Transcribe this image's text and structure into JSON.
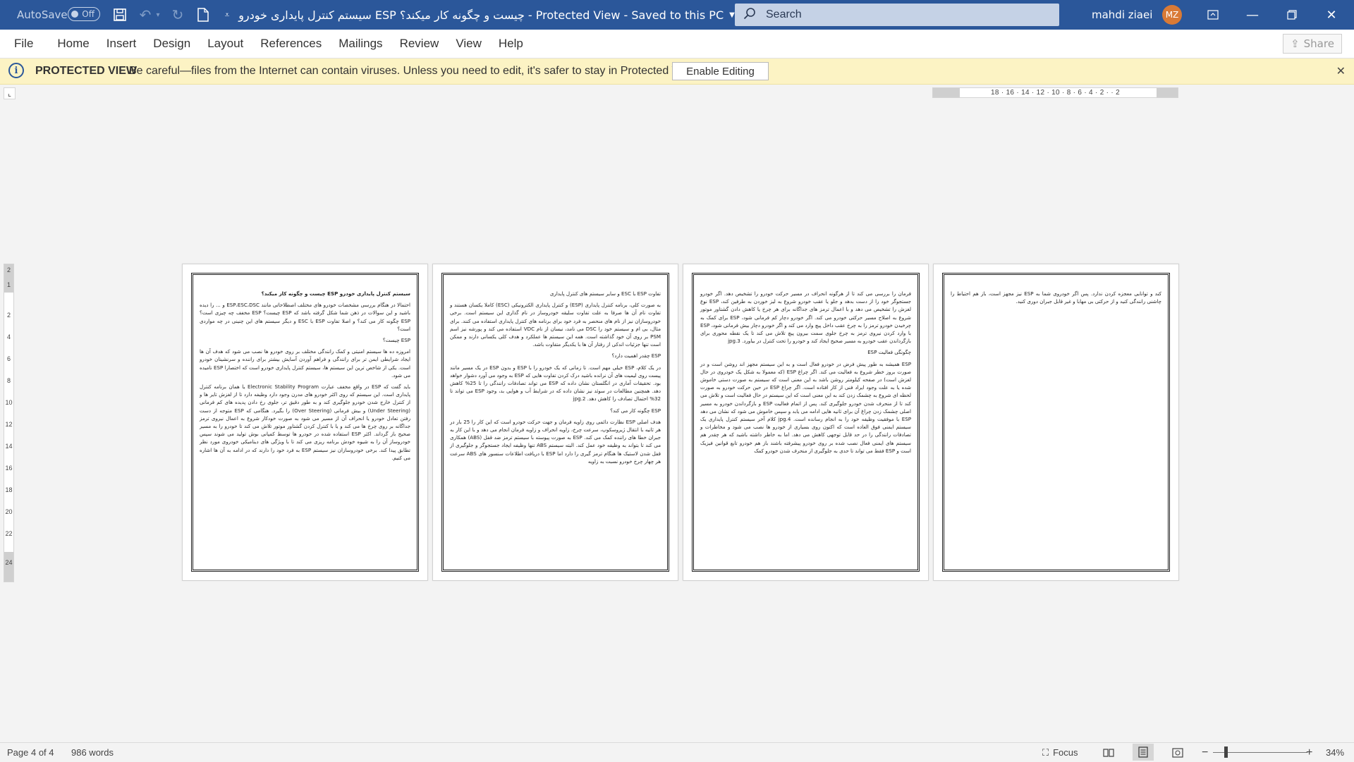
{
  "titlebar": {
    "autosave_label": "AutoSave",
    "autosave_state": "Off",
    "doc_title": "سیستم کنترل پایداری خودرو ESP چیست و چگونه کار میکند؟ - Protected View - Saved to this PC",
    "search_placeholder": "Search",
    "user_name": "mahdi ziaei",
    "user_initials": "MZ",
    "accent_color": "#2b579a",
    "avatar_color": "#d97a36"
  },
  "menu": {
    "tabs": [
      "File",
      "Home",
      "Insert",
      "Design",
      "Layout",
      "References",
      "Mailings",
      "Review",
      "View",
      "Help"
    ],
    "share_label": "Share"
  },
  "protected_view": {
    "title": "PROTECTED VIEW",
    "message": "Be careful—files from the Internet can contain viruses. Unless you need to edit, it's safer to stay in Protected View.",
    "enable_label": "Enable Editing",
    "bar_color": "#fcf3c4"
  },
  "rulers": {
    "horizontal": "2 · · 2 · 4 · 6 · 8 · 10 · 12 · 14 · 16 · 18",
    "vertical": [
      "2",
      "1",
      "2",
      "4",
      "6",
      "8",
      "10",
      "12",
      "14",
      "16",
      "18",
      "20",
      "22",
      "24"
    ]
  },
  "pages": [
    {
      "paragraphs": [
        {
          "heading": true,
          "text": "سیستم کنترل پایداری خودرو ESP چیست و چگونه کار میکند؟"
        },
        {
          "heading": false,
          "text": "احتمالا در هنگام بررسی مشخصات خودرو های مختلف اصطلاحاتی مانند ESP،ESC،DSC و ... را دیده باشید و این سوالات در ذهن شما شکل گرفته باشد که ESP چیست؟ ESP مخفف چه چیزی است؟ ESP چگونه کار می کند؟ و اصلا تفاوت ESP با ESC و دیگر سیستم های این چنینی در چه مواردی است؟"
        },
        {
          "heading": false,
          "text": "ESP چیست؟"
        },
        {
          "heading": false,
          "text": "امروزه ده ها سیستم امنیتی و کمک رانندگی مختلف بر روی خودرو ها نصب می شود که هدف آن ها ایجاد شرایطی ایمن تر برای رانندگی و فراهم آوردن آسایش بیشتر برای راننده و سرنشینان خودرو است. یکی از شاخص ترین این سیستم ها، سیستم کنترل پایداری خودرو است که اختصارا ESP نامیده می شود."
        },
        {
          "heading": false,
          "text": "باید گفت که ESP در واقع مخفف عبارت Electronic Stability Program یا همان برنامه کنترل پایداری است. این سیستم که روی اکثر خودرو های مدرن وجود دارد وظیفه دارد تا از لغزش تایر ها و از کنترل خارج شدن خودرو جلوگیری کند و به طور دقیق تر، جلوی رخ دادن پدیده های کم فرمانی (Under Steering) و بیش فرمانی (Over Steering) را بگیرد. هنگامی که ESP متوجه از دست رفتن تعادل خودرو یا انحراف آن از مسیر می شود به صورت خودکار شروع به اعمال نیروی ترمز جداگانه بر روی چرخ ها می کند و یا با کنترل کردن گشتاور موتور تلاش می کند تا خودرو را به مسیر صحیح باز گرداند. اکثر ESP استفاده شده در خودرو ها توسط کمپانی بوش تولید می شوند سپس خودروساز آن را به شیوه خودش برنامه ریزی می کند تا با ویژگی های دینامیکی خودروی مورد نظر تطابق پیدا کند. برخی خودروسازان نیز سیستم ESP به فرد خود را دارند که در ادامه به آن ها اشاره می کنیم."
        }
      ]
    },
    {
      "paragraphs": [
        {
          "heading": false,
          "text": "تفاوت ESP با ESC و سایر سیستم های کنترل پایداری"
        },
        {
          "heading": false,
          "text": "به صورت کلی، برنامه کنترل پایداری (ESP) و کنترل پایداری الکترونیکی (ESC) کاملا یکسان هستند و تفاوت نام آن ها صرفا به علت تفاوت سلیقه خودروساز در نام گذاری این سیستم است. برخی خودروسازان نیز از نام های منحصر به فرد خود برای برنامه های کنترل پایداری استفاده می کنند. برای مثال، بی ام و سیستم خود را DSC می نامد، نیسان از نام VDC استفاده می کند و پورشه نیز اسم PSM بر روی آن خود گذاشته است. همه این سیستم ها عملکرد و هدف کلی یکسانی دارند و ممکن است تنها جزئیات اندکی از رفتار آن ها با یکدیگر متفاوت باشد."
        },
        {
          "heading": false,
          "text": "ESP چقدر اهمیت دارد؟"
        },
        {
          "heading": false,
          "text": "در یک کلام، ESP خیلی مهم است. تا زمانی که یک خودرو را با ESP و بدون ESP در یک مسیر مانند پیست روی لیمیت های آن نرانده باشید درک کردن تفاوت هایی که ESP به وجود می آورد دشوار خواهد بود. تحقیقات آماری در انگلستان نشان داده که ESP می تواند تصادفات رانندگی را تا 25% کاهش دهد. همچنین مطالعات در سوئد نیز نشان داده که در شرایط آب و هوایی بد، وجود ESP می تواند تا 32% احتمال تصادف را کاهش دهد. jpg.2"
        },
        {
          "heading": false,
          "text": "ESP چگونه کار می کند؟"
        },
        {
          "heading": false,
          "text": "هدف اصلی ESP نظارت دائمی روی زاویه فرمان و جهت حرکت خودرو است که این کار را 25 بار در هر ثانیه با انتقال ژیروسکوپ، سرعت چرخ، زاویه انحراف و زاویه فرمان انجام می دهد و با این کار به جبران خطا های راننده کمک می کند. ESP به صورت پیوسته با سیستم ترمز ضد قفل (ABS) همکاری می کند تا بتواند به وظیفه خود عمل کند. البته سیستم ABS تنها وظیفه ایجاد جستجوگر و جلوگیری از قفل شدن لاستیک ها هنگام ترمز گیری را دارد اما ESP با دریافت اطلاعات سنسور های ABS سرعت هر چهار چرخ خودرو نسبت به زاویه"
        }
      ]
    },
    {
      "paragraphs": [
        {
          "heading": false,
          "text": "فرمان را بررسی می کند تا از هرگونه انحراف در مسیر حرکت خودرو را تشخیص دهد. اگر خودرو جستجوگر خود را از دست بدهد و جلو یا عقب خودرو شروع به لیز خوردن به طرفین کند، ESP نوع لغزش را تشخیص می دهد و با اعمال ترمز های جداگانه برای هر چرخ یا کاهش دادن گشتاور موتور شروع به اصلاح مسیر حرکتی خودرو می کند. اگر خودرو دچار کم فرمانی شود، ESP برای کمک به چرخیدن خودرو ترمز را به چرخ عقب داخل پیچ وارد می کند و اگر خودرو دچار بیش فرمانی شود، ESP با وارد کردن نیروی ترمز به چرخ جلوی سمت بیرون پیچ تلاش می کند تا یک نقطه محوری برای بازگرداندن عقب خودرو به مسیر صحیح ایجاد کند و خودرو را تحت کنترل در بیاورد. jpg.3"
        },
        {
          "heading": false,
          "text": "چگونگی فعالیت ESP"
        },
        {
          "heading": false,
          "text": "ESP همیشه به طور پیش فرض در خودرو فعال است و به این سیستم مجهز اند روشن است و در صورت بروز خطر شروع به فعالیت می کند. اگر چراغ ESP (که معمولا به شکل یک خودروی در حال لغزش است) در صفحه کیلومتر روشن باشد به این معنی است که سیستم به صورت دستی خاموش شده یا به علت وجود ایراد فنی از کار افتاده است. اگر چراغ ESP در حین حرکت خودرو به صورت لحظه ای شروع به چشمک زدن کند به این معنی است که این سیستم در حال فعالیت است و تلاش می کند تا از منحرف شدن خودرو جلوگیری کند. پس از اتمام فعالیت ESP و بازگرداندن خودرو به مسیر اصلی چشمک زدن چراغ آن برای ثانیه هایی ادامه می یابد و سپس خاموش می شود که نشان می دهد ESP با موفقیت وظیفه خود را به انجام رسانده است. jpg.4 کلام آخر سیستم کنترل پایداری یک سیستم ایمنی فوق العاده است که اکنون روی بسیاری از خودرو ها نصب می شود و مخاطرات و تصادفات رانندگی را در حد قابل توجهی کاهش می دهد. اما به خاطر داشته باشید که هر چقدر هم سیستم های ایمنی فعال نصب شده بر روی خودرو پیشرفته باشند باز هم خودرو تابع قوانین فیزیک است و ESP فقط می تواند تا حدی به جلوگیری از منحرف شدن خودرو کمک"
        }
      ]
    },
    {
      "paragraphs": [
        {
          "heading": false,
          "text": "کند و توانایی معجزه کردن ندارد. پس اگر خودروی شما به ESP نیز مجهز است، باز هم احتیاط را چاشنی رانندگی کنید و از حرکتی بی مهابا و غیر قابل جبران دوری کنید."
        }
      ]
    }
  ],
  "status": {
    "page_info": "Page 4 of 4",
    "word_count": "986 words",
    "focus_label": "Focus",
    "zoom_minus": "−",
    "zoom_plus": "+",
    "zoom_level": "34%",
    "zoom_fraction": 0.14
  }
}
